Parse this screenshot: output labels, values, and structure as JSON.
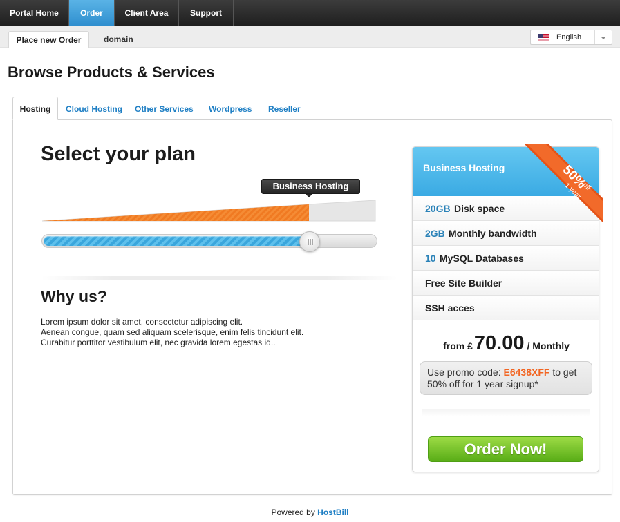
{
  "topnav": {
    "items": [
      {
        "label": "Portal Home"
      },
      {
        "label": "Order"
      },
      {
        "label": "Client Area"
      },
      {
        "label": "Support"
      }
    ],
    "active_index": 1
  },
  "subnav": {
    "active_tab": "Place new Order",
    "link": "domain"
  },
  "language": {
    "label": "English",
    "flag": "us-flag-icon"
  },
  "page_title": "Browse Products & Services",
  "category_tabs": [
    {
      "label": "Hosting"
    },
    {
      "label": "Cloud Hosting"
    },
    {
      "label": "Other Services"
    },
    {
      "label": "Wordpress"
    },
    {
      "label": "Reseller"
    }
  ],
  "active_category_index": 0,
  "plan_selector": {
    "heading": "Select your plan",
    "tooltip": "Business Hosting",
    "slider_level": 0.8
  },
  "why_us": {
    "heading": "Why us?",
    "lines": [
      "Lorem ipsum dolor sit amet, consectetur adipiscing elit.",
      "Aenean congue, quam sed aliquam scelerisque, enim felis tincidunt elit.",
      "Curabitur porttitor vestibulum elit, nec gravida lorem egestas id.."
    ]
  },
  "plan_card": {
    "title": "Business Hosting",
    "ribbon": {
      "percent": "50%",
      "off": "off",
      "period": "1 year"
    },
    "features": [
      {
        "num": "20GB",
        "text": "Disk space"
      },
      {
        "num": "2GB",
        "text": "Monthly bandwidth"
      },
      {
        "num": "10",
        "text": "MySQL Databases"
      },
      {
        "num": "",
        "text": "Free Site Builder"
      },
      {
        "num": "",
        "text": "SSH acces"
      }
    ],
    "price": {
      "prefix": "from £",
      "amount": "70.00",
      "period": "/ Monthly"
    },
    "promo": {
      "before": "Use promo code: ",
      "code": "E6438XFF",
      "after": " to get 50% off for 1 year signup*"
    },
    "order_button": "Order Now!"
  },
  "footer": {
    "text": "Powered by ",
    "link": "HostBill"
  },
  "colors": {
    "accent_blue": "#3aaae3",
    "orange": "#f26522",
    "green": "#59ad17",
    "link": "#1f7fc4"
  }
}
